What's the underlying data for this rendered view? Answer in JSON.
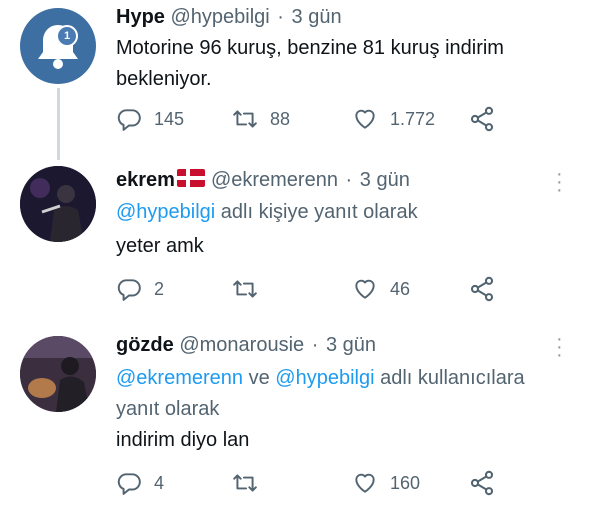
{
  "tweets": [
    {
      "name": "Hype",
      "handle": "@hypebilgi",
      "time": "3 gün",
      "badge": "1",
      "text_lines": [
        "Motorine 96 kuruş, benzine 81 kuruş indirim",
        "bekleniyor."
      ],
      "replies": "145",
      "retweets": "88",
      "likes": "1.772"
    },
    {
      "name": "ekrem",
      "handle": "@ekremerenn",
      "time": "3 gün",
      "reply_to_mention": "@hypebilgi",
      "reply_to_suffix": " adlı kişiye yanıt olarak",
      "text": "yeter amk",
      "replies": "2",
      "likes": "46"
    },
    {
      "name": "gözde",
      "handle": "@monarousie",
      "time": "3 gün",
      "reply_to_mention_1": "@ekremerenn",
      "reply_to_middle": " ve ",
      "reply_to_mention_2": "@hypebilgi",
      "reply_to_suffix_1": " adlı kullanıcılara",
      "reply_to_suffix_2": "yanıt olarak",
      "text": "indirim diyo lan",
      "replies": "4",
      "likes": "160"
    }
  ],
  "separator": "·",
  "icons": [
    "reply-icon",
    "retweet-icon",
    "like-icon",
    "share-icon",
    "more-icon",
    "bell-icon",
    "denmark-flag-icon"
  ],
  "colors": {
    "mention": "#1d9bf0",
    "secondary": "#536471",
    "thread_line": "#cfd9de"
  }
}
